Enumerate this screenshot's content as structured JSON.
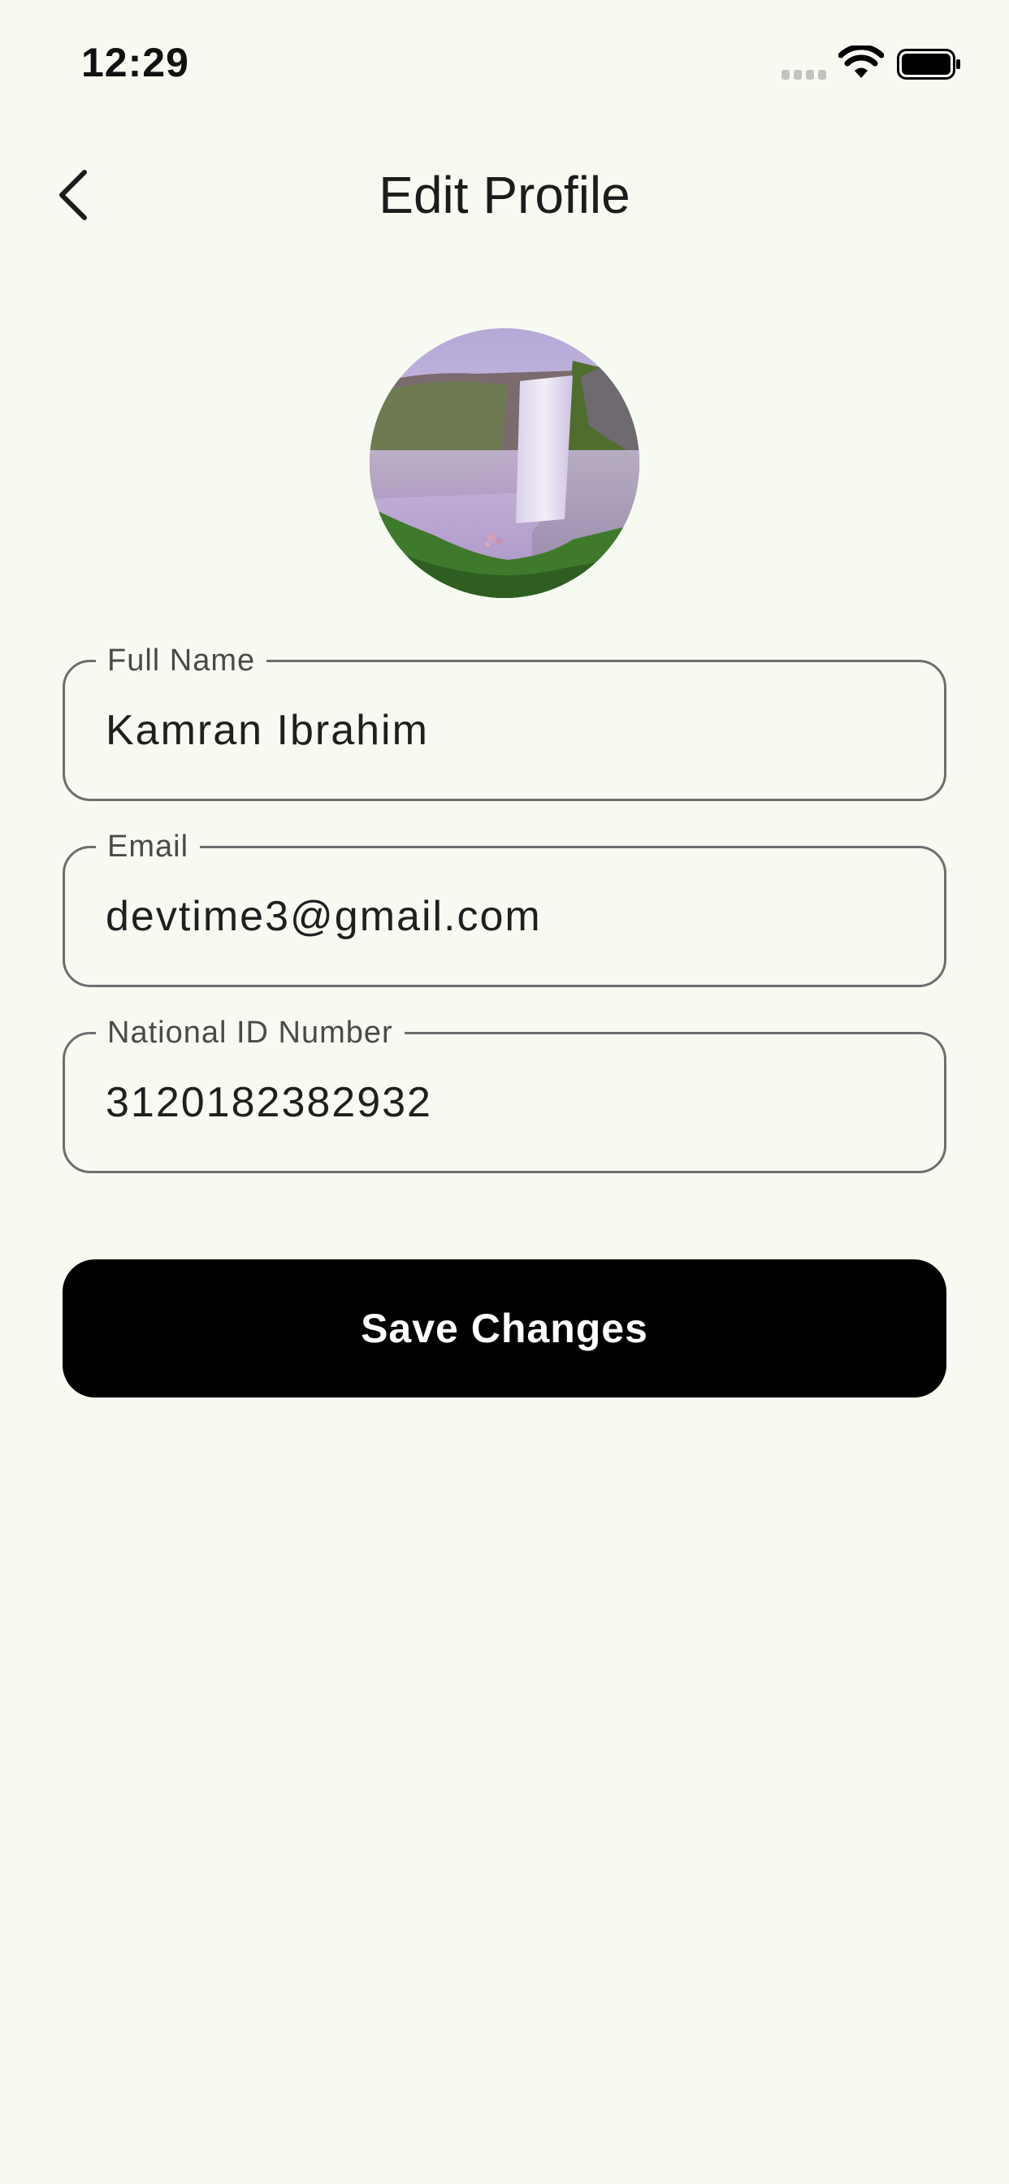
{
  "status_bar": {
    "time": "12:29",
    "icons": [
      "signal-icon",
      "wifi-icon",
      "battery-icon"
    ]
  },
  "app_bar": {
    "title": "Edit Profile",
    "back_icon": "chevron-left-icon"
  },
  "form": {
    "full_name": {
      "label": "Full Name",
      "value": "Kamran Ibrahim"
    },
    "email": {
      "label": "Email",
      "value": "devtime3@gmail.com"
    },
    "national_id": {
      "label": "National ID Number",
      "value": "3120182382932"
    }
  },
  "save_button": {
    "label": "Save Changes"
  },
  "colors": {
    "background": "#f6faf1",
    "field_border": "#6e6e6e",
    "button_background": "#000000",
    "button_text": "#ffffff"
  }
}
